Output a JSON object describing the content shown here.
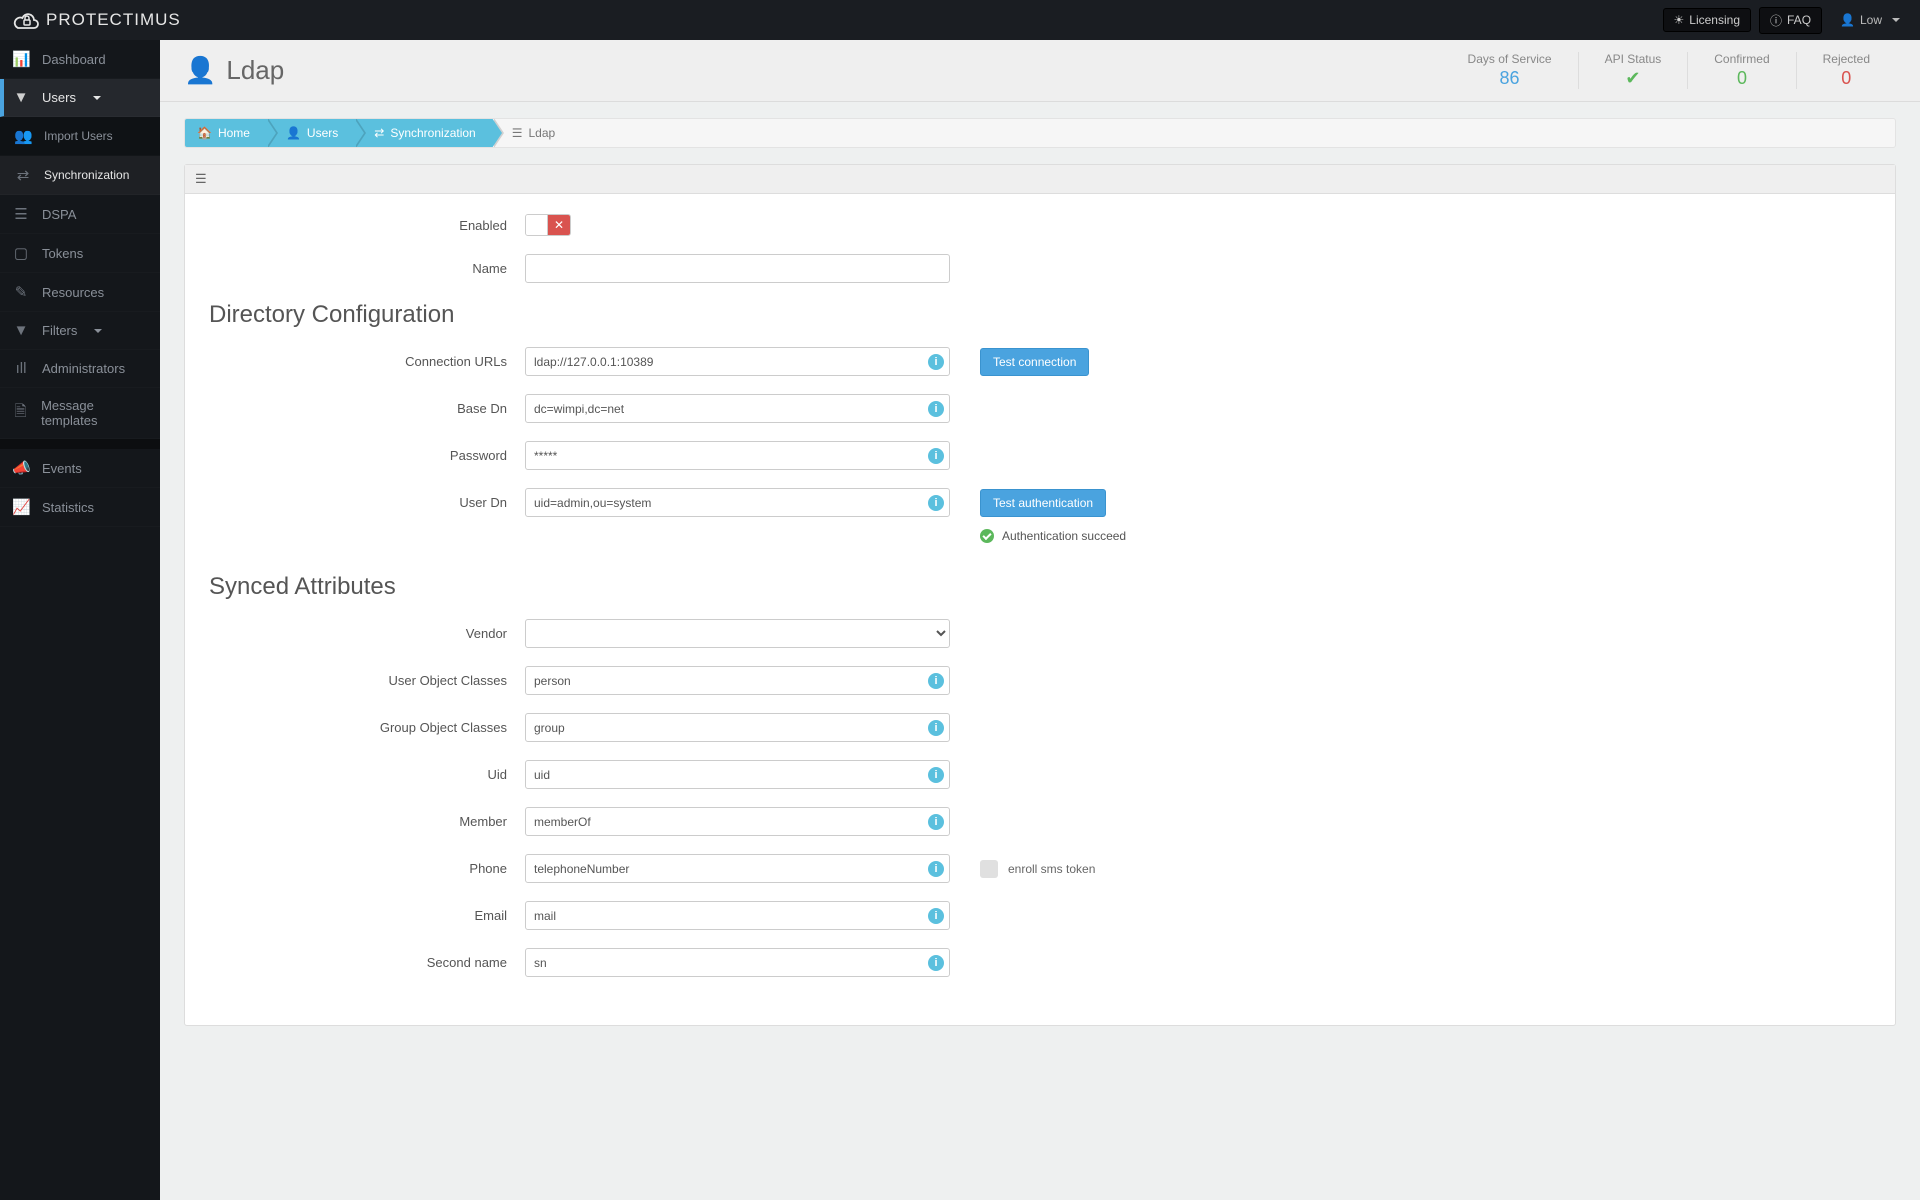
{
  "brand": "PROTECTIMUS",
  "topbar": {
    "licensing": "Licensing",
    "faq": "FAQ",
    "user": "Low"
  },
  "sidebar": {
    "dashboard": "Dashboard",
    "users": "Users",
    "import_users": "Import Users",
    "synchronization": "Synchronization",
    "dspa": "DSPA",
    "tokens": "Tokens",
    "resources": "Resources",
    "filters": "Filters",
    "administrators": "Administrators",
    "message_templates": "Message templates",
    "events": "Events",
    "statistics": "Statistics"
  },
  "page": {
    "title": "Ldap"
  },
  "stats": {
    "days_label": "Days of Service",
    "days_value": "86",
    "api_label": "API Status",
    "confirmed_label": "Confirmed",
    "confirmed_value": "0",
    "rejected_label": "Rejected",
    "rejected_value": "0"
  },
  "breadcrumb": {
    "home": "Home",
    "users": "Users",
    "sync": "Synchronization",
    "ldap": "Ldap"
  },
  "form": {
    "enabled_label": "Enabled",
    "name_label": "Name",
    "name_value": "",
    "section_dir": "Directory Configuration",
    "conn_label": "Connection URLs",
    "conn_value": "ldap://127.0.0.1:10389",
    "test_conn": "Test connection",
    "basedn_label": "Base Dn",
    "basedn_value": "dc=wimpi,dc=net",
    "password_label": "Password",
    "password_value": "*****",
    "userdn_label": "User Dn",
    "userdn_value": "uid=admin,ou=system",
    "test_auth": "Test authentication",
    "auth_succeed": "Authentication succeed",
    "section_synced": "Synced Attributes",
    "vendor_label": "Vendor",
    "uoc_label": "User Object Classes",
    "uoc_value": "person",
    "goc_label": "Group Object Classes",
    "goc_value": "group",
    "uid_label": "Uid",
    "uid_value": "uid",
    "member_label": "Member",
    "member_value": "memberOf",
    "phone_label": "Phone",
    "phone_value": "telephoneNumber",
    "enroll_sms": "enroll sms token",
    "email_label": "Email",
    "email_value": "mail",
    "second_name_label": "Second name",
    "second_name_value": "sn"
  }
}
